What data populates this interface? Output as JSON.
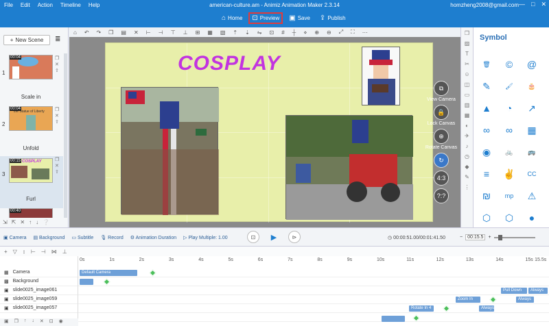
{
  "menu": [
    "File",
    "Edit",
    "Action",
    "Timeline",
    "Help"
  ],
  "window_title": "american-culture.am - Animiz Animation Maker 2.3.14",
  "user": "homzheng2008@gmail.com",
  "window_controls": [
    "—",
    "□",
    "✕"
  ],
  "main_toolbar": {
    "home": "Home",
    "preview": "Preview",
    "save": "Save",
    "publish": "Publish"
  },
  "new_scene": "New Scene",
  "scenes": [
    {
      "num": "1",
      "time": "00:04",
      "label": "Scale in"
    },
    {
      "num": "2",
      "time": "00:04",
      "label": "Unfold"
    },
    {
      "num": "3",
      "time": "00:15",
      "label": "Furl"
    },
    {
      "num": "4",
      "time": "00:40",
      "label": ""
    }
  ],
  "scene2_caption": "the Statue of Liberty",
  "canvas": {
    "title": "COSPLAY"
  },
  "canvas_buttons": [
    {
      "icon": "⧉",
      "label": "View Camera"
    },
    {
      "icon": "🔒",
      "label": "Lock Canvas"
    },
    {
      "icon": "⊕",
      "label": "Rotate Canvas"
    },
    {
      "icon": "↻",
      "label": ""
    },
    {
      "icon": "4:3",
      "label": ""
    },
    {
      "icon": "?:?",
      "label": ""
    }
  ],
  "symbol_panel": {
    "title": "Symbol",
    "icons": [
      "🗑",
      "©",
      "@",
      "✎",
      "🖌",
      "🎂",
      "▲",
      "◔",
      "↗",
      "∞",
      "∞",
      "▦",
      "◉",
      "🚲",
      "🚌",
      "≡",
      "✌",
      "CC",
      "₪",
      "mp",
      "⚠",
      "⬡",
      "⬡",
      "●"
    ]
  },
  "timeline_options": [
    "Camera",
    "Background",
    "Subtitle",
    "Record",
    "Animation Duration",
    "Play Multiple: 1.00"
  ],
  "time_readout": "00:00:51.00/00:01:41.50",
  "zoom_value": "00:15.5",
  "ruler": [
    "0s",
    "1s",
    "2s",
    "3s",
    "4s",
    "5s",
    "6s",
    "7s",
    "8s",
    "9s",
    "10s",
    "11s",
    "12s",
    "13s",
    "14s",
    "15s",
    "15.5s"
  ],
  "tracks": [
    {
      "name": "Camera",
      "bar": "Default Camera"
    },
    {
      "name": "Background",
      "bar": ""
    },
    {
      "name": "slide0025_image061",
      "bar": "Pull Down",
      "end": "Always"
    },
    {
      "name": "slide0025_image059",
      "bar": "Zoom In",
      "end": "Always"
    },
    {
      "name": "slide0025_image057",
      "bar": "Rotate In 4",
      "end": "Always"
    }
  ]
}
